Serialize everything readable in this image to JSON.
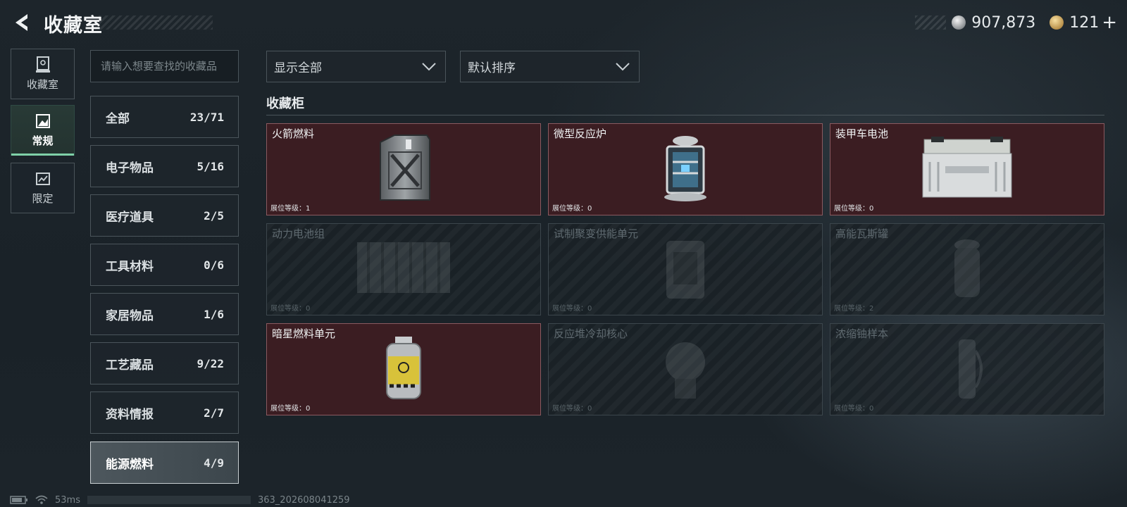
{
  "header": {
    "title": "收藏室",
    "silver_amount": "907,873",
    "gold_amount": "121",
    "add_label": "+"
  },
  "rail": [
    {
      "label": "收藏室",
      "icon": "trophy-case-icon"
    },
    {
      "label": "常规",
      "icon": "landscape-icon",
      "active": true
    },
    {
      "label": "限定",
      "icon": "picture-icon"
    }
  ],
  "search": {
    "placeholder": "请输入想要查找的收藏品"
  },
  "categories": [
    {
      "label": "全部",
      "count": "23/71"
    },
    {
      "label": "电子物品",
      "count": "5/16"
    },
    {
      "label": "医疗道具",
      "count": "2/5"
    },
    {
      "label": "工具材料",
      "count": "0/6"
    },
    {
      "label": "家居物品",
      "count": "1/6"
    },
    {
      "label": "工艺藏品",
      "count": "9/22"
    },
    {
      "label": "资料情报",
      "count": "2/7"
    },
    {
      "label": "能源燃料",
      "count": "4/9",
      "active": true
    }
  ],
  "filters": {
    "show": "显示全部",
    "sort": "默认排序"
  },
  "section_title": "收藏柜",
  "items": [
    {
      "name": "火箭燃料",
      "level": "展位等级：1",
      "owned": true,
      "icon": "fuel-can-icon"
    },
    {
      "name": "微型反应炉",
      "level": "展位等级：0",
      "owned": true,
      "icon": "reactor-icon"
    },
    {
      "name": "装甲车电池",
      "level": "展位等级：0",
      "owned": true,
      "icon": "battery-icon"
    },
    {
      "name": "动力电池组",
      "level": "展位等级：0",
      "owned": false,
      "icon": "battery-pack-icon"
    },
    {
      "name": "试制聚变供能单元",
      "level": "展位等级：0",
      "owned": false,
      "icon": "fusion-unit-icon"
    },
    {
      "name": "高能瓦斯罐",
      "level": "展位等级：2",
      "owned": false,
      "icon": "gas-tank-icon"
    },
    {
      "name": "暗星燃料单元",
      "level": "展位等级：0",
      "owned": true,
      "icon": "fuel-cell-icon"
    },
    {
      "name": "反应堆冷却核心",
      "level": "展位等级：0",
      "owned": false,
      "icon": "cooling-core-icon"
    },
    {
      "name": "浓缩铀样本",
      "level": "展位等级：0",
      "owned": false,
      "icon": "uranium-sample-icon"
    }
  ],
  "footer": {
    "ping": "53ms",
    "version": "363_202608041259"
  }
}
